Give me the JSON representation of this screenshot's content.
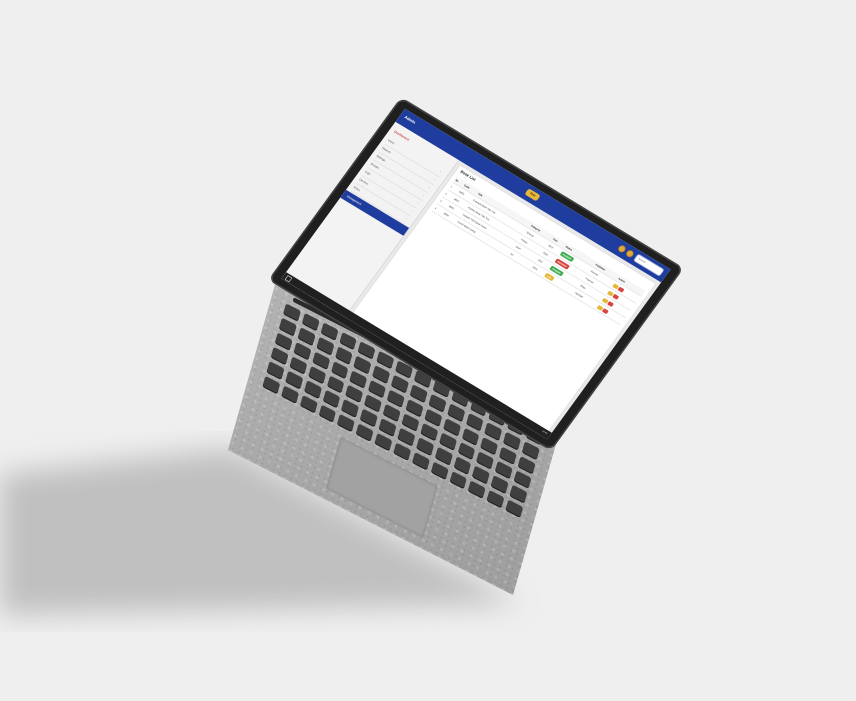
{
  "app": {
    "brand": "Admin",
    "top_button": "Data",
    "search_placeholder": "Search"
  },
  "sidebar": {
    "title": "Dashboard",
    "items": [
      "Users",
      "Reports",
      "Settings",
      "Groups",
      "Logs",
      "Devices",
      "Roles"
    ],
    "active_item": "Management"
  },
  "main": {
    "panel_title": "Book List",
    "columns": [
      "No",
      "Code",
      "Title",
      "Category",
      "Year",
      "Status",
      "Publisher",
      "Action"
    ],
    "rows": [
      {
        "no": "1",
        "code": "B001",
        "title": "Example Book Title One",
        "category": "Science",
        "year": "2019",
        "status": "Available",
        "publisher": "Elsevier"
      },
      {
        "no": "2",
        "code": "B002",
        "title": "Another Book Title Two",
        "category": "History",
        "year": "2020",
        "status": "Borrowed",
        "publisher": "Pearson"
      },
      {
        "no": "3",
        "code": "B003",
        "title": "Sample Third Book Name",
        "category": "Math",
        "year": "2021",
        "status": "Available",
        "publisher": "Wiley"
      },
      {
        "no": "4",
        "code": "B004",
        "title": "Fourth Book Listing",
        "category": "Art",
        "year": "2018",
        "status": "Lost",
        "publisher": "Springer"
      }
    ]
  },
  "taskbar": {
    "time": "10:45"
  },
  "colors": {
    "primary": "#1f3d9e",
    "accent": "#e8b73a",
    "danger": "#d9463f",
    "success": "#3fae54"
  }
}
